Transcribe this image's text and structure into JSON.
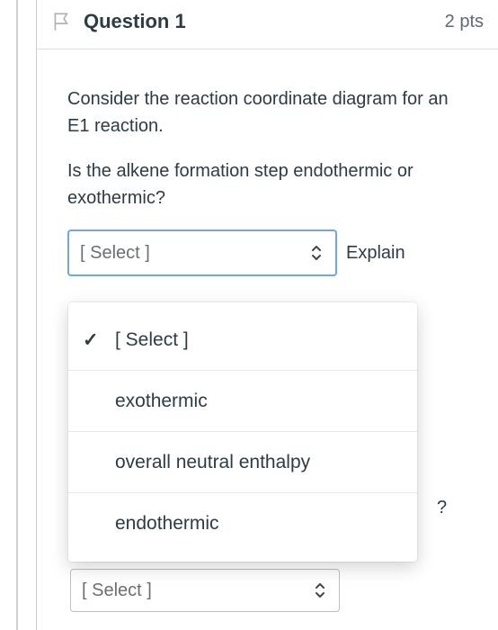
{
  "header": {
    "title": "Question 1",
    "points": "2 pts"
  },
  "body": {
    "p1": "Consider the reaction coordinate diagram for an E1 reaction.",
    "p2": "Is the alkene formation step endothermic or exothermic?"
  },
  "select": {
    "placeholder": "[ Select ]",
    "explain": "Explain",
    "options": [
      "[ Select ]",
      "exothermic",
      "overall neutral enthalpy",
      "endothermic"
    ],
    "selected_index": 0
  },
  "bottom_select": {
    "placeholder": "[ Select ]"
  },
  "stray": {
    "qmark": "?",
    "bar": "|"
  }
}
